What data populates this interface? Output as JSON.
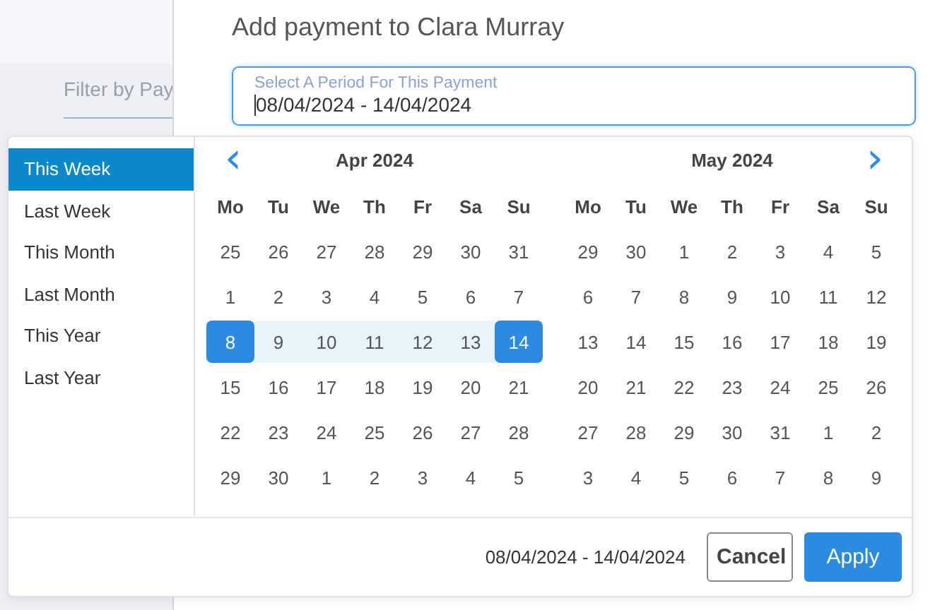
{
  "background": {
    "filter_label": "Filter by Pay"
  },
  "modal": {
    "title": "Add payment to Clara Murray",
    "period_field": {
      "label": "Select A Period For This Payment",
      "value": "08/04/2024 - 14/04/2024"
    }
  },
  "date_picker": {
    "presets": [
      {
        "label": "This Week",
        "selected": true
      },
      {
        "label": "Last Week",
        "selected": false
      },
      {
        "label": "This Month",
        "selected": false
      },
      {
        "label": "Last Month",
        "selected": false
      },
      {
        "label": "This Year",
        "selected": false
      },
      {
        "label": "Last Year",
        "selected": false
      }
    ],
    "months": [
      {
        "title": "Apr 2024",
        "nav": {
          "kind": "prev",
          "icon": "‹"
        },
        "weekdays": [
          "Mo",
          "Tu",
          "We",
          "Th",
          "Fr",
          "Sa",
          "Su"
        ],
        "weeks": [
          [
            {
              "day": "25",
              "selected": false,
              "in_range": false
            },
            {
              "day": "26",
              "selected": false,
              "in_range": false
            },
            {
              "day": "27",
              "selected": false,
              "in_range": false
            },
            {
              "day": "28",
              "selected": false,
              "in_range": false
            },
            {
              "day": "29",
              "selected": false,
              "in_range": false
            },
            {
              "day": "30",
              "selected": false,
              "in_range": false
            },
            {
              "day": "31",
              "selected": false,
              "in_range": false
            }
          ],
          [
            {
              "day": "1",
              "selected": false,
              "in_range": false
            },
            {
              "day": "2",
              "selected": false,
              "in_range": false
            },
            {
              "day": "3",
              "selected": false,
              "in_range": false
            },
            {
              "day": "4",
              "selected": false,
              "in_range": false
            },
            {
              "day": "5",
              "selected": false,
              "in_range": false
            },
            {
              "day": "6",
              "selected": false,
              "in_range": false
            },
            {
              "day": "7",
              "selected": false,
              "in_range": false
            }
          ],
          [
            {
              "day": "8",
              "selected": true,
              "in_range": false
            },
            {
              "day": "9",
              "selected": false,
              "in_range": true
            },
            {
              "day": "10",
              "selected": false,
              "in_range": true
            },
            {
              "day": "11",
              "selected": false,
              "in_range": true
            },
            {
              "day": "12",
              "selected": false,
              "in_range": true
            },
            {
              "day": "13",
              "selected": false,
              "in_range": true
            },
            {
              "day": "14",
              "selected": true,
              "in_range": false
            }
          ],
          [
            {
              "day": "15",
              "selected": false,
              "in_range": false
            },
            {
              "day": "16",
              "selected": false,
              "in_range": false
            },
            {
              "day": "17",
              "selected": false,
              "in_range": false
            },
            {
              "day": "18",
              "selected": false,
              "in_range": false
            },
            {
              "day": "19",
              "selected": false,
              "in_range": false
            },
            {
              "day": "20",
              "selected": false,
              "in_range": false
            },
            {
              "day": "21",
              "selected": false,
              "in_range": false
            }
          ],
          [
            {
              "day": "22",
              "selected": false,
              "in_range": false
            },
            {
              "day": "23",
              "selected": false,
              "in_range": false
            },
            {
              "day": "24",
              "selected": false,
              "in_range": false
            },
            {
              "day": "25",
              "selected": false,
              "in_range": false
            },
            {
              "day": "26",
              "selected": false,
              "in_range": false
            },
            {
              "day": "27",
              "selected": false,
              "in_range": false
            },
            {
              "day": "28",
              "selected": false,
              "in_range": false
            }
          ],
          [
            {
              "day": "29",
              "selected": false,
              "in_range": false
            },
            {
              "day": "30",
              "selected": false,
              "in_range": false
            },
            {
              "day": "1",
              "selected": false,
              "in_range": false
            },
            {
              "day": "2",
              "selected": false,
              "in_range": false
            },
            {
              "day": "3",
              "selected": false,
              "in_range": false
            },
            {
              "day": "4",
              "selected": false,
              "in_range": false
            },
            {
              "day": "5",
              "selected": false,
              "in_range": false
            }
          ]
        ]
      },
      {
        "title": "May 2024",
        "nav": {
          "kind": "next",
          "icon": "›"
        },
        "weekdays": [
          "Mo",
          "Tu",
          "We",
          "Th",
          "Fr",
          "Sa",
          "Su"
        ],
        "weeks": [
          [
            {
              "day": "29",
              "selected": false,
              "in_range": false
            },
            {
              "day": "30",
              "selected": false,
              "in_range": false
            },
            {
              "day": "1",
              "selected": false,
              "in_range": false
            },
            {
              "day": "2",
              "selected": false,
              "in_range": false
            },
            {
              "day": "3",
              "selected": false,
              "in_range": false
            },
            {
              "day": "4",
              "selected": false,
              "in_range": false
            },
            {
              "day": "5",
              "selected": false,
              "in_range": false
            }
          ],
          [
            {
              "day": "6",
              "selected": false,
              "in_range": false
            },
            {
              "day": "7",
              "selected": false,
              "in_range": false
            },
            {
              "day": "8",
              "selected": false,
              "in_range": false
            },
            {
              "day": "9",
              "selected": false,
              "in_range": false
            },
            {
              "day": "10",
              "selected": false,
              "in_range": false
            },
            {
              "day": "11",
              "selected": false,
              "in_range": false
            },
            {
              "day": "12",
              "selected": false,
              "in_range": false
            }
          ],
          [
            {
              "day": "13",
              "selected": false,
              "in_range": false
            },
            {
              "day": "14",
              "selected": false,
              "in_range": false
            },
            {
              "day": "15",
              "selected": false,
              "in_range": false
            },
            {
              "day": "16",
              "selected": false,
              "in_range": false
            },
            {
              "day": "17",
              "selected": false,
              "in_range": false
            },
            {
              "day": "18",
              "selected": false,
              "in_range": false
            },
            {
              "day": "19",
              "selected": false,
              "in_range": false
            }
          ],
          [
            {
              "day": "20",
              "selected": false,
              "in_range": false
            },
            {
              "day": "21",
              "selected": false,
              "in_range": false
            },
            {
              "day": "22",
              "selected": false,
              "in_range": false
            },
            {
              "day": "23",
              "selected": false,
              "in_range": false
            },
            {
              "day": "24",
              "selected": false,
              "in_range": false
            },
            {
              "day": "25",
              "selected": false,
              "in_range": false
            },
            {
              "day": "26",
              "selected": false,
              "in_range": false
            }
          ],
          [
            {
              "day": "27",
              "selected": false,
              "in_range": false
            },
            {
              "day": "28",
              "selected": false,
              "in_range": false
            },
            {
              "day": "29",
              "selected": false,
              "in_range": false
            },
            {
              "day": "30",
              "selected": false,
              "in_range": false
            },
            {
              "day": "31",
              "selected": false,
              "in_range": false
            },
            {
              "day": "1",
              "selected": false,
              "in_range": false
            },
            {
              "day": "2",
              "selected": false,
              "in_range": false
            }
          ],
          [
            {
              "day": "3",
              "selected": false,
              "in_range": false
            },
            {
              "day": "4",
              "selected": false,
              "in_range": false
            },
            {
              "day": "5",
              "selected": false,
              "in_range": false
            },
            {
              "day": "6",
              "selected": false,
              "in_range": false
            },
            {
              "day": "7",
              "selected": false,
              "in_range": false
            },
            {
              "day": "8",
              "selected": false,
              "in_range": false
            },
            {
              "day": "9",
              "selected": false,
              "in_range": false
            }
          ]
        ]
      }
    ],
    "selected_range": "08/04/2024 - 14/04/2024",
    "buttons": [
      {
        "label": "Cancel",
        "kind": "secondary"
      },
      {
        "label": "Apply",
        "kind": "primary"
      }
    ]
  }
}
